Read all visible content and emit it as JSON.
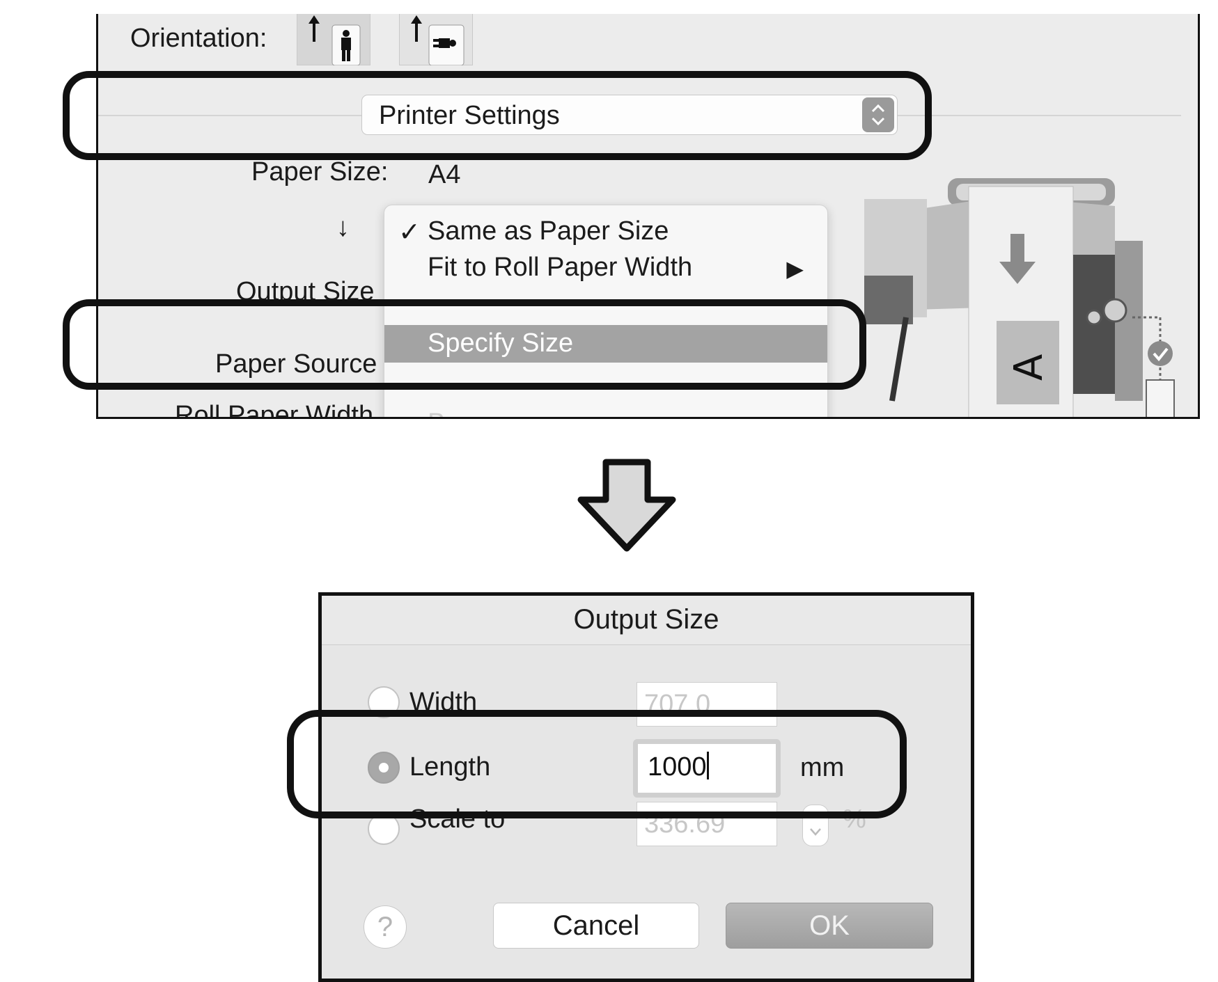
{
  "print_dialog": {
    "orientation_label": "Orientation:",
    "panel_select": "Printer Settings",
    "paper_size_label": "Paper Size:",
    "paper_size_value": "A4",
    "output_size_label": "Output Size",
    "paper_source_label": "Paper Source",
    "roll_paper_width_label": "Roll Paper Width",
    "menu": {
      "items": [
        {
          "label": "Same as Paper Size",
          "checked": true
        },
        {
          "label": "Fit to Roll Paper Width",
          "submenu": true
        },
        {
          "label": "Specify Size",
          "highlighted": true
        },
        {
          "label": "Banner",
          "faded": true
        }
      ],
      "check_glyph": "✓",
      "submenu_glyph": "▶"
    },
    "down_glyph": "↓"
  },
  "output_size_dialog": {
    "title": "Output Size",
    "width_label": "Width",
    "width_value": "707.0",
    "length_label": "Length",
    "length_value": "1000",
    "length_unit": "mm",
    "scale_label": "Scale to",
    "scale_value": "336.69",
    "scale_unit": "%",
    "selected_option": "Length",
    "help_label": "?",
    "cancel_label": "Cancel",
    "ok_label": "OK"
  },
  "colors": {
    "callout_border": "#111111",
    "highlight": "#a3a3a3",
    "panel_bg": "#ececec"
  }
}
